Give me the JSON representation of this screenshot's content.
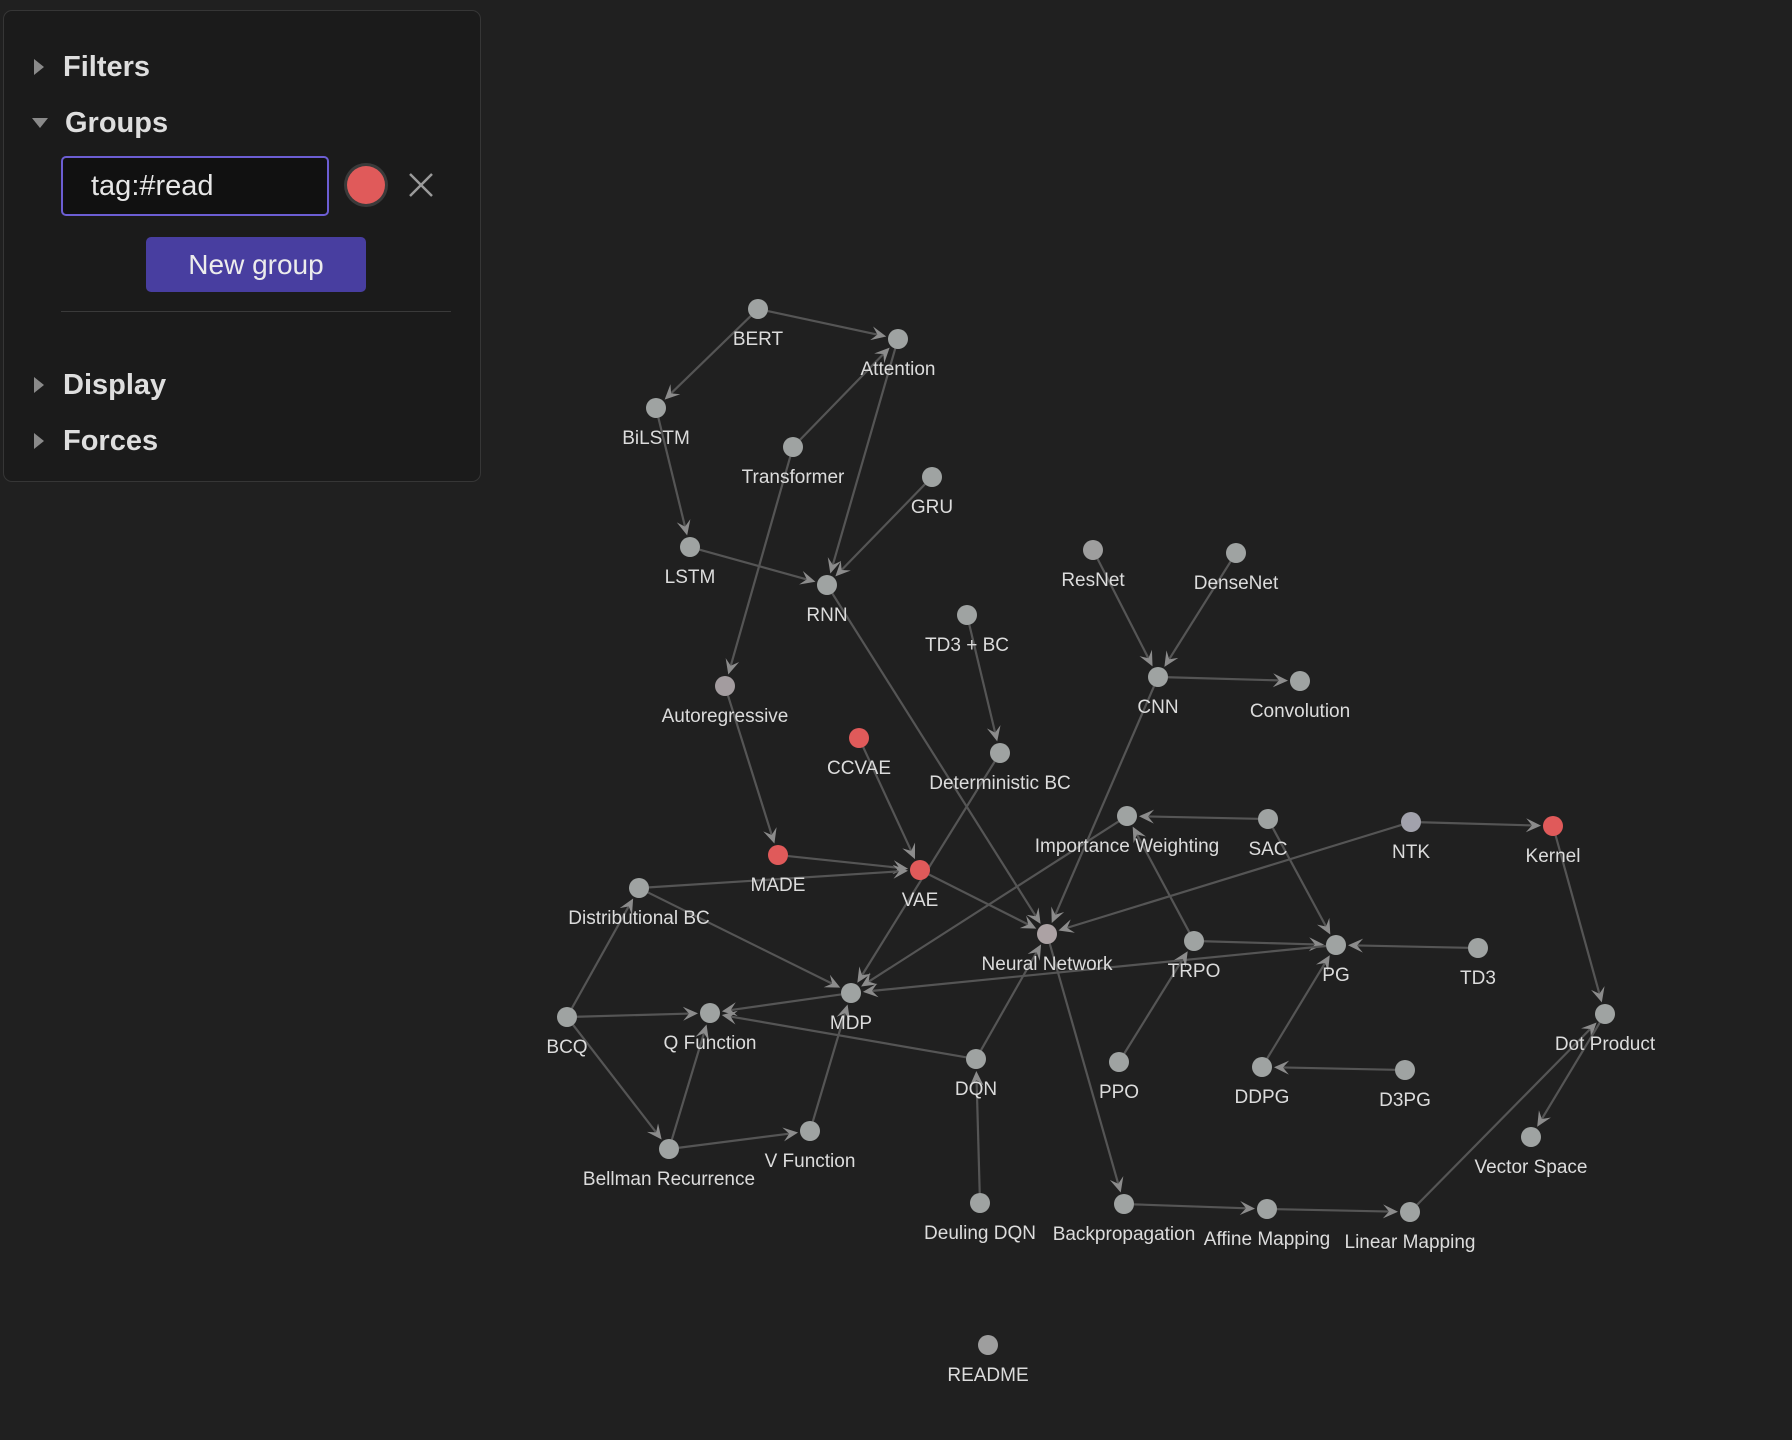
{
  "panel": {
    "sections": {
      "filters": {
        "label": "Filters",
        "expanded": false
      },
      "groups": {
        "label": "Groups",
        "expanded": true
      },
      "display": {
        "label": "Display",
        "expanded": false
      },
      "forces": {
        "label": "Forces",
        "expanded": false
      }
    },
    "group_query": {
      "value": "tag:#read",
      "color": "#e05a5a"
    },
    "new_group_label": "New group"
  },
  "colors": {
    "node_default": "#9fa3a2",
    "node_highlight": "#e05a5a",
    "edge": "#555555",
    "arrow": "#8c8c8c"
  },
  "graph": {
    "nodes": [
      {
        "id": "BERT",
        "label": "BERT"
      },
      {
        "id": "Attention",
        "label": "Attention"
      },
      {
        "id": "BiLSTM",
        "label": "BiLSTM"
      },
      {
        "id": "Transformer",
        "label": "Transformer"
      },
      {
        "id": "GRU",
        "label": "GRU"
      },
      {
        "id": "LSTM",
        "label": "LSTM"
      },
      {
        "id": "RNN",
        "label": "RNN"
      },
      {
        "id": "ResNet",
        "label": "ResNet"
      },
      {
        "id": "DenseNet",
        "label": "DenseNet"
      },
      {
        "id": "TD3BC",
        "label": "TD3 + BC"
      },
      {
        "id": "CNN",
        "label": "CNN"
      },
      {
        "id": "Convolution",
        "label": "Convolution"
      },
      {
        "id": "Autoregressive",
        "label": "Autoregressive"
      },
      {
        "id": "CCVAE",
        "label": "CCVAE",
        "tagged": true
      },
      {
        "id": "DeterministicBC",
        "label": "Deterministic BC"
      },
      {
        "id": "ImportanceWeighting",
        "label": "Importance Weighting"
      },
      {
        "id": "SAC",
        "label": "SAC"
      },
      {
        "id": "NTK",
        "label": "NTK"
      },
      {
        "id": "Kernel",
        "label": "Kernel",
        "tagged": true
      },
      {
        "id": "MADE",
        "label": "MADE",
        "tagged": true
      },
      {
        "id": "VAE",
        "label": "VAE",
        "tagged": true
      },
      {
        "id": "DistributionalBC",
        "label": "Distributional BC"
      },
      {
        "id": "NeuralNetwork",
        "label": "Neural Network"
      },
      {
        "id": "TRPO",
        "label": "TRPO"
      },
      {
        "id": "PG",
        "label": "PG"
      },
      {
        "id": "TD3",
        "label": "TD3"
      },
      {
        "id": "MDP",
        "label": "MDP"
      },
      {
        "id": "BCQ",
        "label": "BCQ"
      },
      {
        "id": "QFunction",
        "label": "Q Function"
      },
      {
        "id": "DQN",
        "label": "DQN"
      },
      {
        "id": "PPO",
        "label": "PPO"
      },
      {
        "id": "DDPG",
        "label": "DDPG"
      },
      {
        "id": "D3PG",
        "label": "D3PG"
      },
      {
        "id": "DotProduct",
        "label": "Dot Product"
      },
      {
        "id": "VFunction",
        "label": "V Function"
      },
      {
        "id": "BellmanRecurrence",
        "label": "Bellman Recurrence"
      },
      {
        "id": "VectorSpace",
        "label": "Vector Space"
      },
      {
        "id": "DeulingDQN",
        "label": "Deuling DQN"
      },
      {
        "id": "Backpropagation",
        "label": "Backpropagation"
      },
      {
        "id": "AffineMapping",
        "label": "Affine Mapping"
      },
      {
        "id": "LinearMapping",
        "label": "Linear Mapping"
      },
      {
        "id": "README",
        "label": "README"
      }
    ],
    "edges": [
      [
        "BERT",
        "Attention"
      ],
      [
        "BERT",
        "BiLSTM"
      ],
      [
        "Transformer",
        "Attention"
      ],
      [
        "Attention",
        "RNN"
      ],
      [
        "BiLSTM",
        "LSTM"
      ],
      [
        "LSTM",
        "RNN"
      ],
      [
        "GRU",
        "RNN"
      ],
      [
        "Transformer",
        "Autoregressive"
      ],
      [
        "RNN",
        "NeuralNetwork"
      ],
      [
        "ResNet",
        "CNN"
      ],
      [
        "DenseNet",
        "CNN"
      ],
      [
        "CNN",
        "Convolution"
      ],
      [
        "CNN",
        "NeuralNetwork"
      ],
      [
        "TD3BC",
        "DeterministicBC"
      ],
      [
        "DeterministicBC",
        "MDP"
      ],
      [
        "Autoregressive",
        "MADE"
      ],
      [
        "MADE",
        "VAE"
      ],
      [
        "CCVAE",
        "VAE"
      ],
      [
        "VAE",
        "NeuralNetwork"
      ],
      [
        "DistributionalBC",
        "VAE"
      ],
      [
        "DistributionalBC",
        "MDP"
      ],
      [
        "SAC",
        "ImportanceWeighting"
      ],
      [
        "SAC",
        "PG"
      ],
      [
        "TRPO",
        "ImportanceWeighting"
      ],
      [
        "ImportanceWeighting",
        "MDP"
      ],
      [
        "NTK",
        "NeuralNetwork"
      ],
      [
        "NTK",
        "Kernel"
      ],
      [
        "TRPO",
        "PG"
      ],
      [
        "TD3",
        "PG"
      ],
      [
        "PG",
        "MDP"
      ],
      [
        "MDP",
        "QFunction"
      ],
      [
        "BCQ",
        "QFunction"
      ],
      [
        "BCQ",
        "DistributionalBC"
      ],
      [
        "BCQ",
        "BellmanRecurrence"
      ],
      [
        "BellmanRecurrence",
        "QFunction"
      ],
      [
        "BellmanRecurrence",
        "VFunction"
      ],
      [
        "VFunction",
        "MDP"
      ],
      [
        "DQN",
        "QFunction"
      ],
      [
        "DQN",
        "NeuralNetwork"
      ],
      [
        "DeulingDQN",
        "DQN"
      ],
      [
        "PPO",
        "TRPO"
      ],
      [
        "DDPG",
        "PG"
      ],
      [
        "D3PG",
        "DDPG"
      ],
      [
        "NeuralNetwork",
        "Backpropagation"
      ],
      [
        "Backpropagation",
        "AffineMapping"
      ],
      [
        "AffineMapping",
        "LinearMapping"
      ],
      [
        "LinearMapping",
        "DotProduct"
      ],
      [
        "Kernel",
        "DotProduct"
      ],
      [
        "DotProduct",
        "VectorSpace"
      ]
    ]
  }
}
